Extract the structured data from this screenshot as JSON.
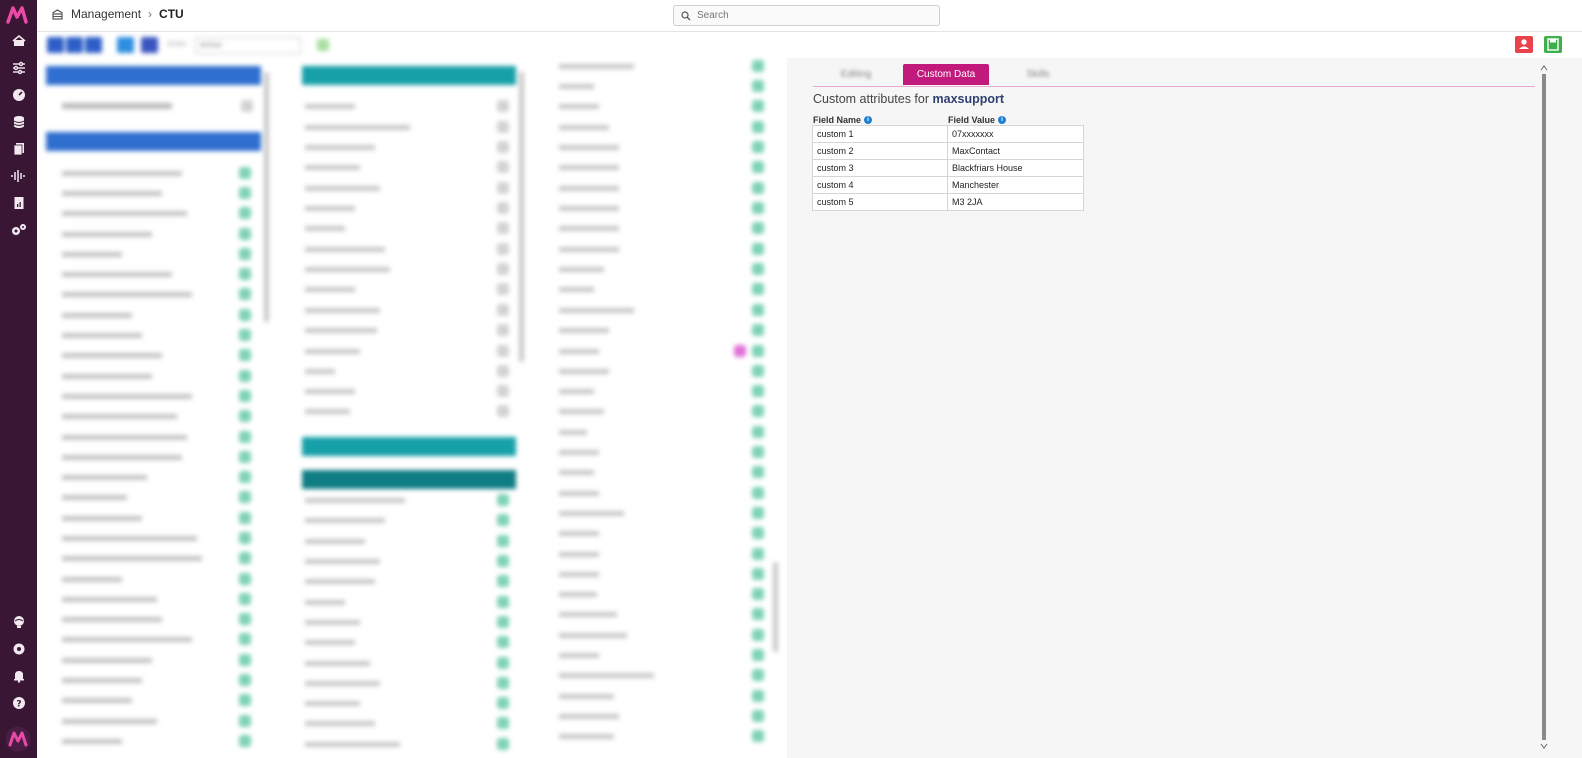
{
  "breadcrumb": {
    "root": "Management",
    "current": "CTU"
  },
  "search": {
    "placeholder": "Search"
  },
  "toolbar": {
    "filter_label": "Enter",
    "filter_value": "Active"
  },
  "tabs": [
    {
      "label": "Editing",
      "active": false
    },
    {
      "label": "Custom Data",
      "active": true
    },
    {
      "label": "Skills",
      "active": false
    }
  ],
  "custom": {
    "heading_prefix": "Custom attributes for",
    "user": "maxsupport",
    "col_name": "Field Name",
    "col_value": "Field Value",
    "rows": [
      {
        "name": "custom 1",
        "value": "07xxxxxxx"
      },
      {
        "name": "custom 2",
        "value": "MaxContact"
      },
      {
        "name": "custom 3",
        "value": "Blackfriars House"
      },
      {
        "name": "custom 4",
        "value": "Manchester"
      },
      {
        "name": "custom 5",
        "value": "M3 2JA"
      }
    ]
  },
  "colors": {
    "brand": "#c2197d",
    "sidebar": "#3a1635",
    "blue_header": "#2f6fd0",
    "teal_header": "#17a0a8",
    "export": "#e8434b",
    "save": "#3cb04a"
  },
  "icons": [
    "home-icon",
    "sliders-icon",
    "gauge-icon",
    "database-icon",
    "files-icon",
    "waveform-icon",
    "report-icon",
    "cogs-icon",
    "globe-icon",
    "gear-icon",
    "bell-icon",
    "help-icon",
    "search-icon",
    "info-icon"
  ]
}
